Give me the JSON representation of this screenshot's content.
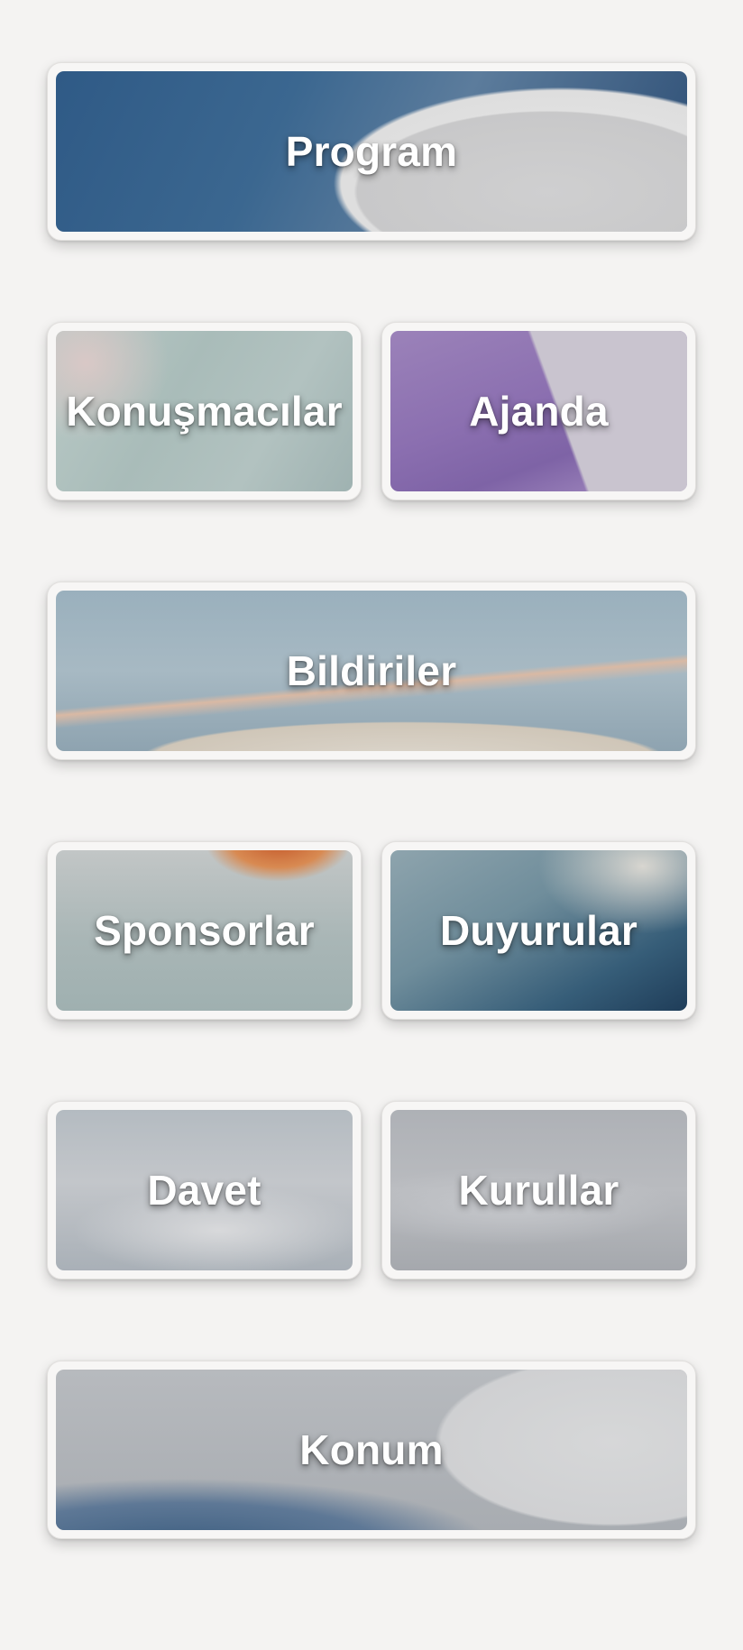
{
  "tiles": [
    {
      "key": "program",
      "label": "Program"
    },
    {
      "key": "konusmacilar",
      "label": "Konuşmacılar"
    },
    {
      "key": "ajanda",
      "label": "Ajanda"
    },
    {
      "key": "bildiriler",
      "label": "Bildiriler"
    },
    {
      "key": "sponsorlar",
      "label": "Sponsorlar"
    },
    {
      "key": "duyurular",
      "label": "Duyurular"
    },
    {
      "key": "davet",
      "label": "Davet"
    },
    {
      "key": "kurullar",
      "label": "Kurullar"
    },
    {
      "key": "konum",
      "label": "Konum"
    }
  ],
  "colors": {
    "page_background": "#f4f3f2",
    "card_border": "#f7f6f5",
    "label_text": "#ffffff"
  }
}
